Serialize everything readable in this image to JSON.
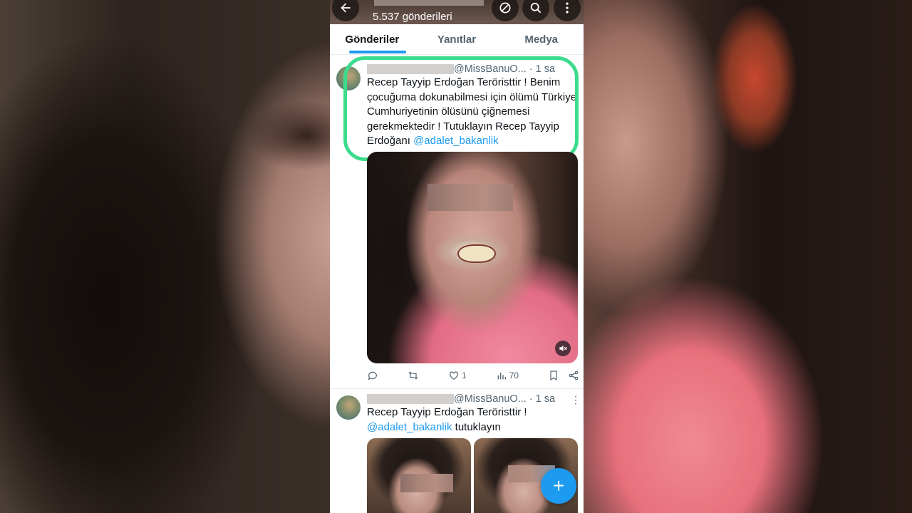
{
  "header": {
    "post_count": "5.537 gönderileri",
    "back_icon": "back-arrow-icon",
    "sync_icon": "circle-slash-icon",
    "search_icon": "search-icon",
    "more_icon": "more-vertical-icon"
  },
  "tabs": [
    {
      "label": "Gönderiler",
      "active": true
    },
    {
      "label": "Yanıtlar",
      "active": false
    },
    {
      "label": "Medya",
      "active": false
    }
  ],
  "posts": [
    {
      "handle": "@MissBanuO...",
      "time": "· 1 sa",
      "text": "Recep Tayyip Erdoğan Teröristtir ! Benim çocuğuma dokunabilmesi için ölümü Türkiye Cumhuriyetinin ölüsünü çiğnemesi gerekmektedir ! Tutuklayın Recep Tayyip Erdoğanı",
      "mention": "@adalet_bakanlik",
      "stats": {
        "likes": "1",
        "views": "70"
      }
    },
    {
      "handle": "@MissBanuO...",
      "time": "· 1 sa",
      "more": "⋮",
      "text": "Recep Tayyip Erdoğan Teröristtir !",
      "mention": "@adalet_bakanlik",
      "text_after": "tutuklayın"
    }
  ],
  "fab": {
    "label": "+"
  },
  "colors": {
    "accent": "#1d9bf0",
    "highlight": "#3bdc8c"
  }
}
